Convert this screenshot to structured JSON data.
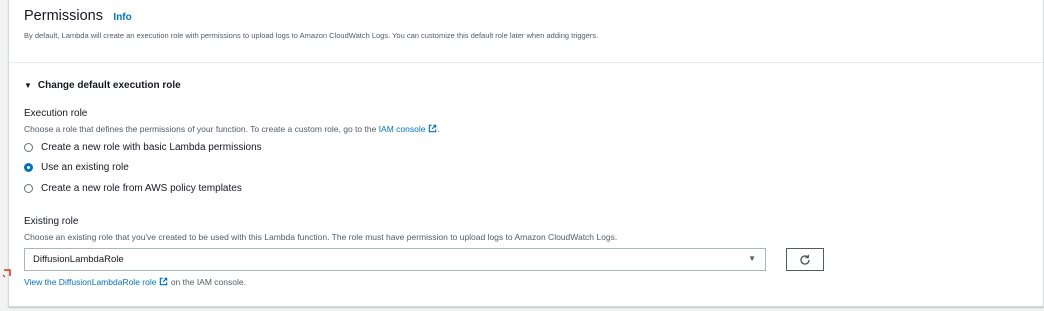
{
  "header": {
    "title": "Permissions",
    "info_link": "Info",
    "description": "By default, Lambda will create an execution role with permissions to upload logs to Amazon CloudWatch Logs. You can customize this default role later when adding triggers."
  },
  "toggle": {
    "label": "Change default execution role",
    "expanded": true
  },
  "execution_role": {
    "label": "Execution role",
    "description_prefix": "Choose a role that defines the permissions of your function. To create a custom role, go to the ",
    "iam_console_link": "IAM console",
    "description_suffix": ".",
    "options": [
      {
        "label": "Create a new role with basic Lambda permissions",
        "selected": false
      },
      {
        "label": "Use an existing role",
        "selected": true
      },
      {
        "label": "Create a new role from AWS policy templates",
        "selected": false
      }
    ]
  },
  "existing_role": {
    "label": "Existing role",
    "description": "Choose an existing role that you've created to be used with this Lambda function. The role must have permission to upload logs to Amazon CloudWatch Logs.",
    "selected_value": "DiffusionLambdaRole",
    "view_link": "View the DiffusionLambdaRole role",
    "view_suffix": " on the IAM console."
  },
  "colors": {
    "link": "#0073bb",
    "text": "#16191f",
    "muted": "#545b64",
    "radio_selected": "#0073bb",
    "marker": "#d13212"
  }
}
